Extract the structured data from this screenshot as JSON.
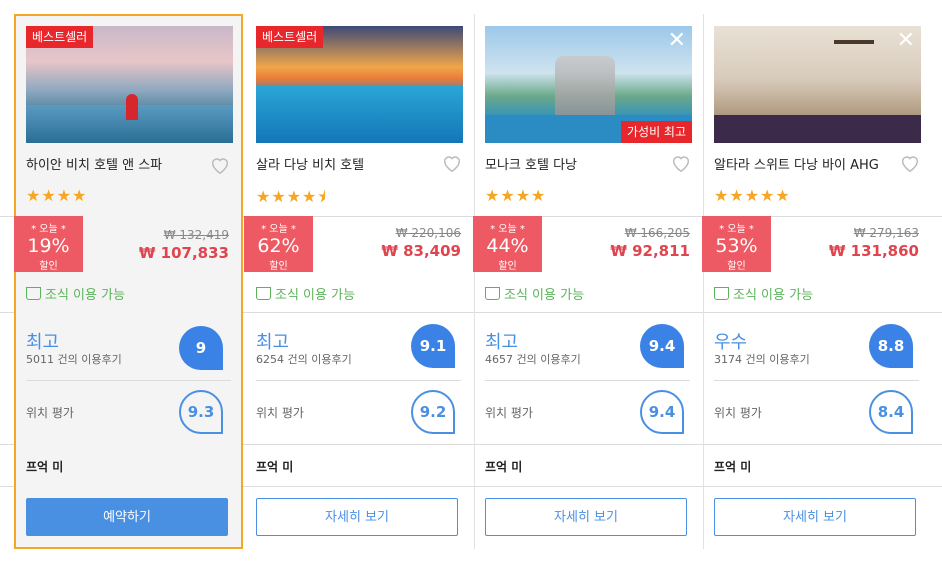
{
  "hotels": [
    {
      "best_badge": "베스트셀러",
      "name": "하이안 비치 호텔 앤 스파",
      "stars": "★★★★",
      "deal_today": "* 오늘 *",
      "discount": "19%",
      "discount_label": "할인",
      "original_price": "₩ 132,419",
      "price": "₩ 107,833",
      "breakfast": "조식 이용 가능",
      "rating_word": "최고",
      "reviews": "5011 건의 이용후기",
      "score": "9",
      "location_label": "위치 평가",
      "location_score": "9.3",
      "rate_label": "프억 미",
      "button": "예약하기"
    },
    {
      "best_badge": "베스트셀러",
      "name": "살라 다낭 비치 호텔",
      "stars": "★★★★⯨",
      "deal_today": "* 오늘 *",
      "discount": "62%",
      "discount_label": "할인",
      "original_price": "₩ 220,106",
      "price": "₩ 83,409",
      "breakfast": "조식 이용 가능",
      "rating_word": "최고",
      "reviews": "6254 건의 이용후기",
      "score": "9.1",
      "location_label": "위치 평가",
      "location_score": "9.2",
      "rate_label": "프억 미",
      "button": "자세히 보기"
    },
    {
      "value_badge": "가성비 최고",
      "name": "모나크 호텔 다낭",
      "stars": "★★★★",
      "deal_today": "* 오늘 *",
      "discount": "44%",
      "discount_label": "할인",
      "original_price": "₩ 166,205",
      "price": "₩ 92,811",
      "breakfast": "조식 이용 가능",
      "rating_word": "최고",
      "reviews": "4657 건의 이용후기",
      "score": "9.4",
      "location_label": "위치 평가",
      "location_score": "9.4",
      "rate_label": "프억 미",
      "button": "자세히 보기"
    },
    {
      "name": "알타라 스위트 다낭 바이 AHG",
      "stars": "★★★★★",
      "deal_today": "* 오늘 *",
      "discount": "53%",
      "discount_label": "할인",
      "original_price": "₩ 279,163",
      "price": "₩ 131,860",
      "breakfast": "조식 이용 가능",
      "rating_word": "우수",
      "reviews": "3174 건의 이용후기",
      "score": "8.8",
      "location_label": "위치 평가",
      "location_score": "8.4",
      "rate_label": "프억 미",
      "button": "자세히 보기"
    }
  ],
  "colors": {
    "accent": "#4a90e2",
    "deal": "#ee5a64",
    "highlight": "#f5a623",
    "badge": "#e8272c"
  },
  "icons": {
    "close": "close-icon",
    "heart": "heart-icon",
    "cup": "coffee-cup-icon"
  }
}
